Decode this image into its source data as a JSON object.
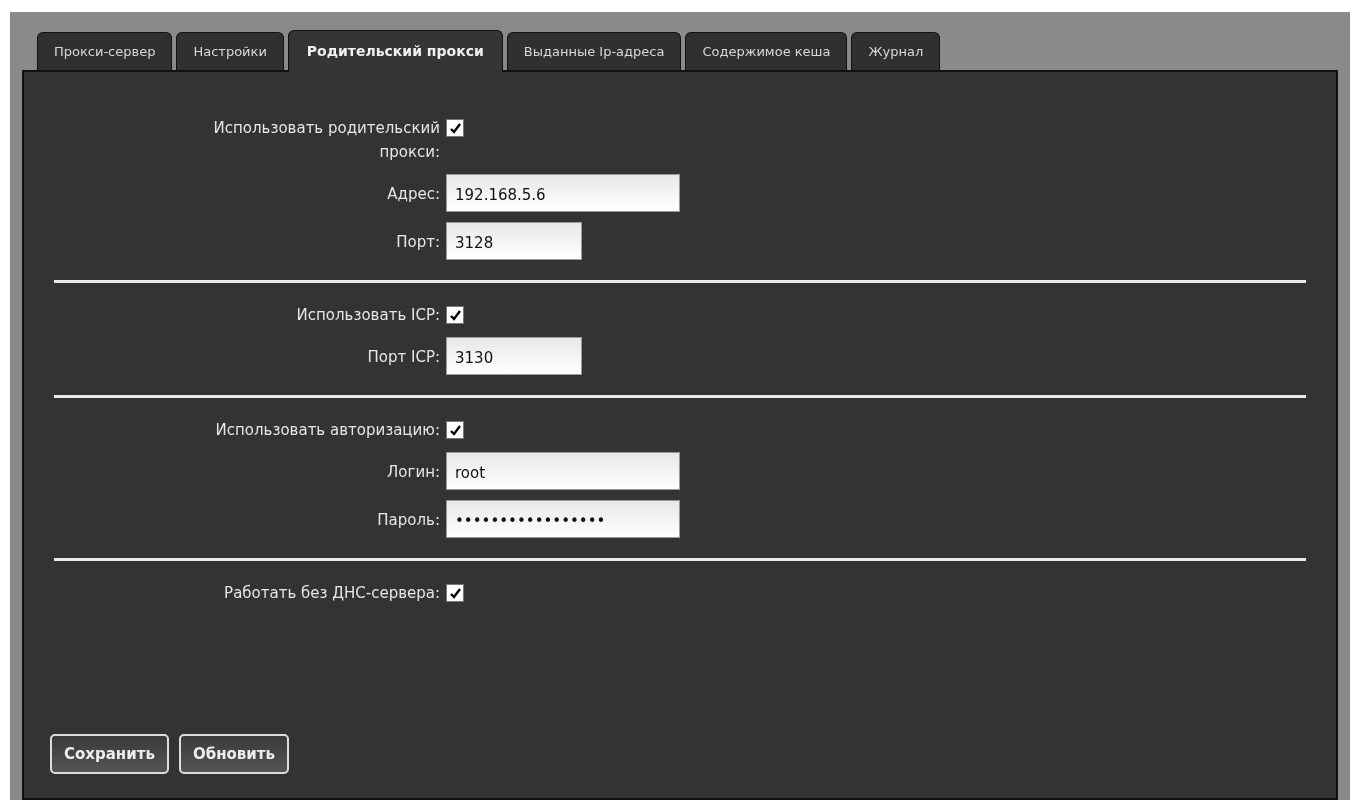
{
  "tabs": [
    {
      "label": "Прокси-сервер",
      "selected": false
    },
    {
      "label": "Настройки",
      "selected": false
    },
    {
      "label": "Родительский прокси",
      "selected": true
    },
    {
      "label": "Выданные Ip-адреса",
      "selected": false
    },
    {
      "label": "Содержимое кеша",
      "selected": false
    },
    {
      "label": "Журнал",
      "selected": false
    }
  ],
  "sections": [
    {
      "rows": [
        {
          "kind": "checkbox",
          "label": "Использовать родительский прокси:",
          "checked": true
        },
        {
          "kind": "field",
          "label": "Адрес:",
          "value": "192.168.5.6"
        },
        {
          "kind": "short_field",
          "label": "Порт:",
          "value": "3128"
        }
      ]
    },
    {
      "rows": [
        {
          "kind": "checkbox",
          "label": "Использовать ICP:",
          "checked": true
        },
        {
          "kind": "short_field",
          "label": "Порт ICP:",
          "value": "3130"
        }
      ]
    },
    {
      "rows": [
        {
          "kind": "checkbox",
          "label": "Использовать авторизацию:",
          "checked": true
        },
        {
          "kind": "field",
          "label": "Логин:",
          "value": "root"
        },
        {
          "kind": "field",
          "label": "Пароль:",
          "value": "•••••••••••••••••"
        }
      ]
    },
    {
      "rows": [
        {
          "kind": "checkbox",
          "label": "Работать без ДНС-сервера:",
          "checked": true
        }
      ]
    }
  ],
  "buttons": [
    "Сохранить",
    "Обновить"
  ]
}
